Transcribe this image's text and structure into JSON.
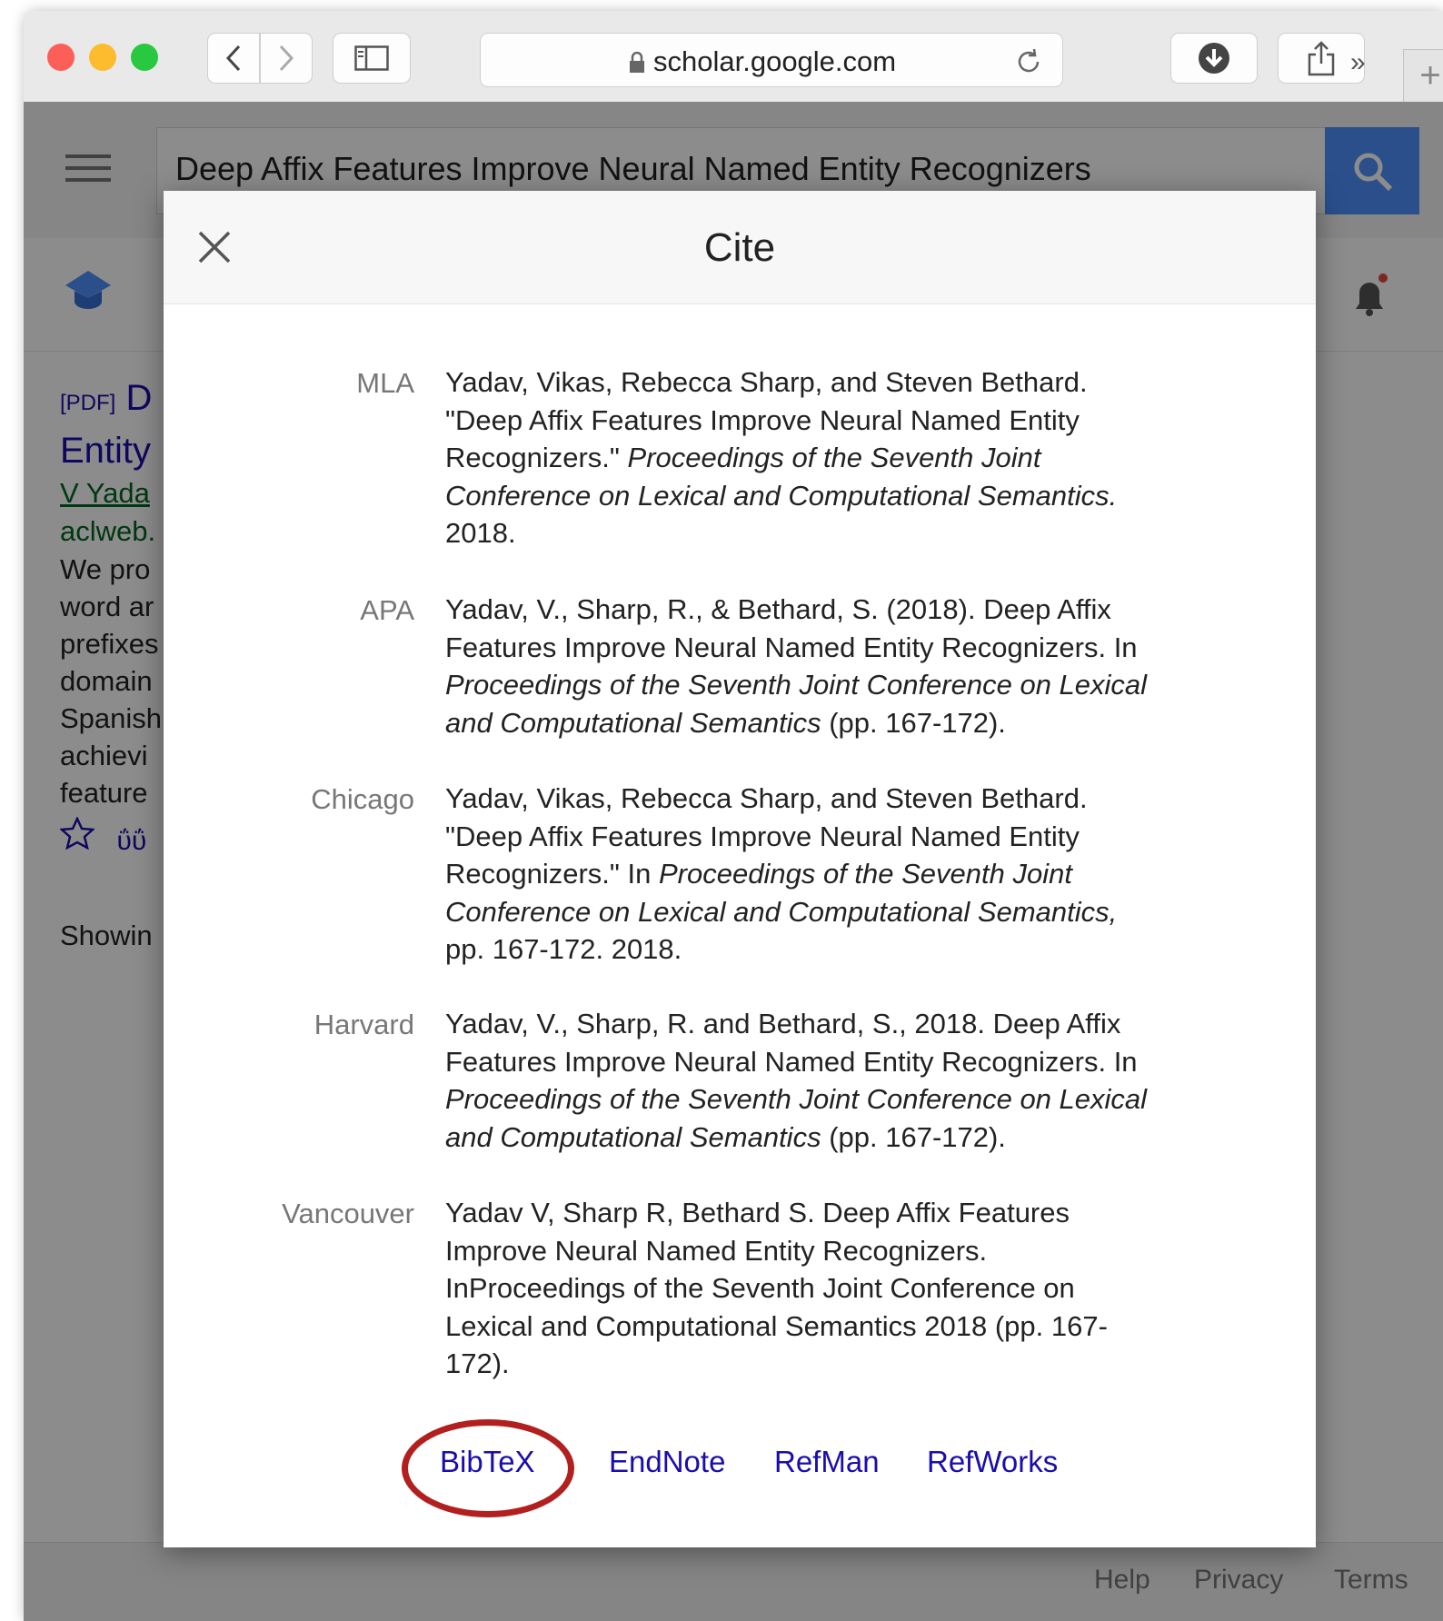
{
  "browser": {
    "url": "scholar.google.com",
    "newtab_label": "+",
    "more_label": "»"
  },
  "scholar": {
    "search_query": "Deep Affix Features Improve Neural Named Entity Recognizers",
    "result_pdf_tag": "[PDF]",
    "result_title_line1": "D",
    "result_title_line2": "Entity",
    "result_authors": "V Yada",
    "result_source": "aclweb.",
    "snippet_lines": [
      "We pro",
      "word ar",
      "prefixes",
      "domain",
      "Spanish",
      "achievi",
      "feature"
    ],
    "cite_link": "ΰΰ",
    "showing": "Showin",
    "footer": {
      "help": "Help",
      "privacy": "Privacy",
      "terms": "Terms"
    }
  },
  "modal": {
    "title": "Cite",
    "citations": [
      {
        "style": "MLA",
        "lines": [
          "Yadav, Vikas, Rebecca Sharp, and Steven Bethard.",
          "\"Deep Affix Features Improve Neural Named Entity",
          "Recognizers.\" ",
          "Proceedings of the Seventh Joint",
          "Conference on Lexical and Computational Semantics.",
          "2018."
        ]
      },
      {
        "style": "APA",
        "lines": [
          "Yadav, V., Sharp, R., & Bethard, S. (2018). Deep Affix",
          "Features Improve Neural Named Entity Recognizers. In",
          "Proceedings of the Seventh Joint Conference on Lexical",
          "and Computational Semantics",
          " (pp. 167-172)."
        ]
      },
      {
        "style": "Chicago",
        "lines": [
          "Yadav, Vikas, Rebecca Sharp, and Steven Bethard.",
          "\"Deep Affix Features Improve Neural Named Entity",
          "Recognizers.\" In ",
          "Proceedings of the Seventh Joint",
          "Conference on Lexical and Computational Semantics,",
          "pp. 167-172. 2018."
        ]
      },
      {
        "style": "Harvard",
        "lines": [
          "Yadav, V., Sharp, R. and Bethard, S., 2018. Deep Affix",
          "Features Improve Neural Named Entity Recognizers. In",
          "Proceedings of the Seventh Joint Conference on Lexical",
          "and Computational Semantics",
          " (pp. 167-172)."
        ]
      },
      {
        "style": "Vancouver",
        "lines": [
          "Yadav V, Sharp R, Bethard S. Deep Affix Features",
          "Improve Neural Named Entity Recognizers.",
          "InProceedings of the Seventh Joint Conference on",
          "Lexical and Computational Semantics 2018 (pp. 167-",
          "172)."
        ]
      }
    ],
    "export_links": [
      "BibTeX",
      "EndNote",
      "RefMan",
      "RefWorks"
    ],
    "highlight_color": "#b21f1f"
  }
}
